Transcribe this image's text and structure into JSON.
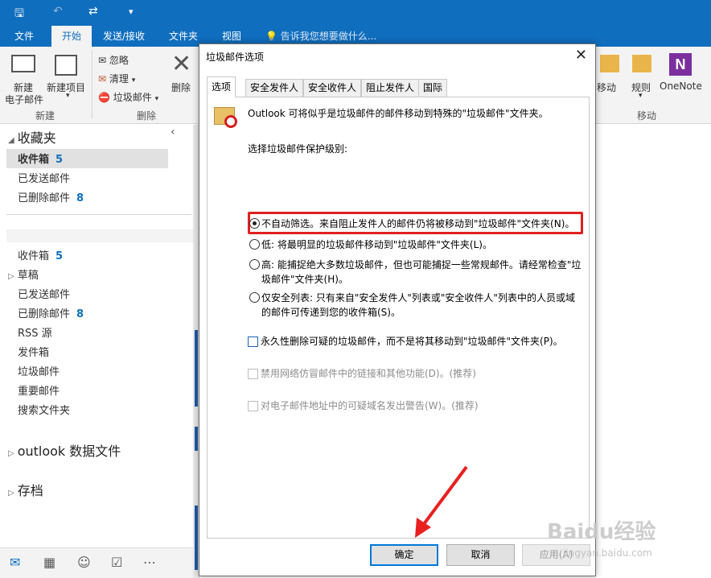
{
  "ribbon_tabs": [
    "文件",
    "开始",
    "发送/接收",
    "文件夹",
    "视图"
  ],
  "tellme": "告诉我您想要做什么...",
  "ribbon": {
    "new_email": "新建",
    "new_email2": "电子邮件",
    "new_items": "新建项目",
    "group_new": "新建",
    "ignore": "忽略",
    "clean": "清理",
    "junk": "垃圾邮件",
    "delete": "删除",
    "group_delete": "删除",
    "move": "移动",
    "rules": "规则",
    "onenote": "OneNote",
    "group_move": "移动"
  },
  "nav": {
    "favorites": "收藏夹",
    "fav_items": [
      {
        "label": "收件箱",
        "count": "5"
      },
      {
        "label": "已发送邮件",
        "count": ""
      },
      {
        "label": "已删除邮件",
        "count": "8"
      }
    ],
    "folders": [
      {
        "label": "收件箱",
        "count": "5"
      },
      {
        "label": "草稿",
        "count": ""
      },
      {
        "label": "已发送邮件",
        "count": ""
      },
      {
        "label": "已删除邮件",
        "count": "8"
      },
      {
        "label": "RSS 源",
        "count": ""
      },
      {
        "label": "发件箱",
        "count": ""
      },
      {
        "label": "垃圾邮件",
        "count": ""
      },
      {
        "label": "重要邮件",
        "count": ""
      },
      {
        "label": "搜索文件夹",
        "count": ""
      }
    ],
    "data_file": "outlook 数据文件",
    "archive": "存档"
  },
  "dialog": {
    "title": "垃圾邮件选项",
    "tabs": [
      "选项",
      "安全发件人",
      "安全收件人",
      "阻止发件人",
      "国际"
    ],
    "intro": "Outlook 可将似乎是垃圾邮件的邮件移动到特殊的\"垃圾邮件\"文件夹。",
    "level_label": "选择垃圾邮件保护级别:",
    "option_none": "不自动筛选。来自阻止发件人的邮件仍将被移动到\"垃圾邮件\"文件夹(N)。",
    "option_low": "低: 将最明显的垃圾邮件移动到\"垃圾邮件\"文件夹(L)。",
    "option_high_1": "高: 能捕捉绝大多数垃圾邮件，但也可能捕捉一些常规邮件。请经常检查\"垃",
    "option_high_2": "圾邮件\"文件夹(H)。",
    "option_safe_1": "仅安全列表: 只有来自\"安全发件人\"列表或\"安全收件人\"列表中的人员或域",
    "option_safe_2": "的邮件可传递到您的收件箱(S)。",
    "perm_delete": "永久性删除可疑的垃圾邮件，而不是将其移动到\"垃圾邮件\"文件夹(P)。",
    "disable_links": "禁用网络仿冒邮件中的链接和其他功能(D)。(推荐)",
    "warn_domain": "对电子邮件地址中的可疑域名发出警告(W)。(推荐)",
    "ok": "确定",
    "cancel": "取消",
    "apply": "应用(A)"
  },
  "watermark": "Baidu经验",
  "watermark_sub": "jingyan.baidu.com"
}
